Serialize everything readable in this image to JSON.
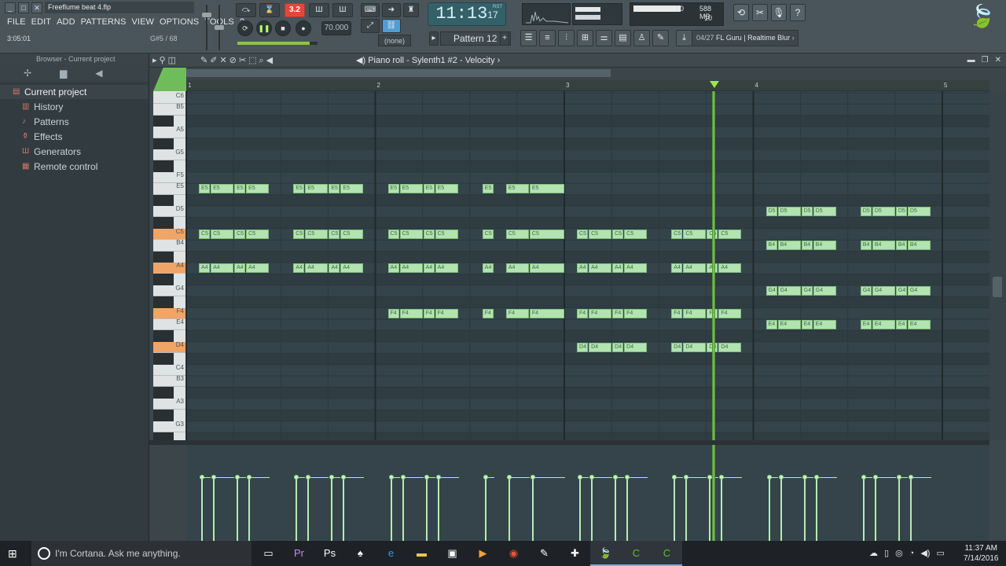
{
  "window": {
    "title": "Freeflume beat 4.flp",
    "controls": [
      "_",
      "□",
      "✕"
    ]
  },
  "menu": [
    "FILE",
    "EDIT",
    "ADD",
    "PATTERNS",
    "VIEW",
    "OPTIONS",
    "TOOLS",
    "?"
  ],
  "hints": {
    "left": "3:05:01",
    "right": "G#5 / 68"
  },
  "transport": {
    "snap_label": "3.2",
    "tempo": "70.000",
    "time_main": "11:13",
    "time_sub": "17",
    "time_corner": "RST",
    "pattern": "Pattern 12",
    "pattern_dest": "(none)",
    "tempo_slider_fraction": 0.9
  },
  "cpu": {
    "top": "10",
    "mem": "588 MB",
    "poly": "10"
  },
  "hint_panel": {
    "index": "04/27",
    "text": "FL Guru | Realtime Blur"
  },
  "browser": {
    "header": "Browser - Current project",
    "root": "Current project",
    "items": [
      {
        "label": "History",
        "icon": "history-icon"
      },
      {
        "label": "Patterns",
        "icon": "patterns-icon"
      },
      {
        "label": "Effects",
        "icon": "effects-icon"
      },
      {
        "label": "Generators",
        "icon": "generators-icon"
      },
      {
        "label": "Remote control",
        "icon": "remote-icon"
      }
    ]
  },
  "piano_roll": {
    "title": "Piano roll - Sylenth1 #2",
    "lane_title": "Velocity",
    "bar_numbers": [
      "1",
      "2",
      "3",
      "4",
      "5"
    ],
    "key_labels": [
      "C6",
      "B5",
      "A5",
      "G5",
      "F5",
      "E5",
      "D5",
      "C5",
      "B4",
      "A4",
      "G4",
      "F4",
      "E4",
      "D4",
      "C4",
      "B3",
      "A3",
      "G3"
    ],
    "highlighted_keys": [
      "C5",
      "A4",
      "F4",
      "D4"
    ]
  },
  "notes": [
    {
      "pitch": "E5",
      "start": 0.0625,
      "len": 0.0625
    },
    {
      "pitch": "E5",
      "start": 0.125,
      "len": 0.125
    },
    {
      "pitch": "E5",
      "start": 0.25,
      "len": 0.0625
    },
    {
      "pitch": "E5",
      "start": 0.3125,
      "len": 0.125
    },
    {
      "pitch": "E5",
      "start": 0.5625,
      "len": 0.0625
    },
    {
      "pitch": "E5",
      "start": 0.625,
      "len": 0.125
    },
    {
      "pitch": "E5",
      "start": 0.75,
      "len": 0.0625
    },
    {
      "pitch": "E5",
      "start": 0.8125,
      "len": 0.125
    },
    {
      "pitch": "E5",
      "start": 1.0625,
      "len": 0.0625
    },
    {
      "pitch": "E5",
      "start": 1.125,
      "len": 0.125
    },
    {
      "pitch": "E5",
      "start": 1.25,
      "len": 0.0625
    },
    {
      "pitch": "E5",
      "start": 1.3125,
      "len": 0.125
    },
    {
      "pitch": "E5",
      "start": 1.5625,
      "len": 0.0625
    },
    {
      "pitch": "E5",
      "start": 1.6875,
      "len": 0.125
    },
    {
      "pitch": "E5",
      "start": 1.8125,
      "len": 0.1875
    },
    {
      "pitch": "C5",
      "start": 0.0625,
      "len": 0.0625
    },
    {
      "pitch": "C5",
      "start": 0.125,
      "len": 0.125
    },
    {
      "pitch": "C5",
      "start": 0.25,
      "len": 0.0625
    },
    {
      "pitch": "C5",
      "start": 0.3125,
      "len": 0.125
    },
    {
      "pitch": "C5",
      "start": 0.5625,
      "len": 0.0625
    },
    {
      "pitch": "C5",
      "start": 0.625,
      "len": 0.125
    },
    {
      "pitch": "C5",
      "start": 0.75,
      "len": 0.0625
    },
    {
      "pitch": "C5",
      "start": 0.8125,
      "len": 0.125
    },
    {
      "pitch": "C5",
      "start": 1.0625,
      "len": 0.0625
    },
    {
      "pitch": "C5",
      "start": 1.125,
      "len": 0.125
    },
    {
      "pitch": "C5",
      "start": 1.25,
      "len": 0.0625
    },
    {
      "pitch": "C5",
      "start": 1.3125,
      "len": 0.125
    },
    {
      "pitch": "C5",
      "start": 1.5625,
      "len": 0.0625
    },
    {
      "pitch": "C5",
      "start": 1.6875,
      "len": 0.125
    },
    {
      "pitch": "C5",
      "start": 1.8125,
      "len": 0.1875
    },
    {
      "pitch": "C5",
      "start": 2.0625,
      "len": 0.0625
    },
    {
      "pitch": "C5",
      "start": 2.125,
      "len": 0.125
    },
    {
      "pitch": "C5",
      "start": 2.25,
      "len": 0.0625
    },
    {
      "pitch": "C5",
      "start": 2.3125,
      "len": 0.125
    },
    {
      "pitch": "C5",
      "start": 2.5625,
      "len": 0.0625
    },
    {
      "pitch": "C5",
      "start": 2.625,
      "len": 0.125
    },
    {
      "pitch": "C5",
      "start": 2.75,
      "len": 0.0625
    },
    {
      "pitch": "C5",
      "start": 2.8125,
      "len": 0.125
    },
    {
      "pitch": "A4",
      "start": 0.0625,
      "len": 0.0625
    },
    {
      "pitch": "A4",
      "start": 0.125,
      "len": 0.125
    },
    {
      "pitch": "A4",
      "start": 0.25,
      "len": 0.0625
    },
    {
      "pitch": "A4",
      "start": 0.3125,
      "len": 0.125
    },
    {
      "pitch": "A4",
      "start": 0.5625,
      "len": 0.0625
    },
    {
      "pitch": "A4",
      "start": 0.625,
      "len": 0.125
    },
    {
      "pitch": "A4",
      "start": 0.75,
      "len": 0.0625
    },
    {
      "pitch": "A4",
      "start": 0.8125,
      "len": 0.125
    },
    {
      "pitch": "A4",
      "start": 1.0625,
      "len": 0.0625
    },
    {
      "pitch": "A4",
      "start": 1.125,
      "len": 0.125
    },
    {
      "pitch": "A4",
      "start": 1.25,
      "len": 0.0625
    },
    {
      "pitch": "A4",
      "start": 1.3125,
      "len": 0.125
    },
    {
      "pitch": "A4",
      "start": 1.5625,
      "len": 0.0625
    },
    {
      "pitch": "A4",
      "start": 1.6875,
      "len": 0.125
    },
    {
      "pitch": "A4",
      "start": 1.8125,
      "len": 0.1875
    },
    {
      "pitch": "A4",
      "start": 2.0625,
      "len": 0.0625
    },
    {
      "pitch": "A4",
      "start": 2.125,
      "len": 0.125
    },
    {
      "pitch": "A4",
      "start": 2.25,
      "len": 0.0625
    },
    {
      "pitch": "A4",
      "start": 2.3125,
      "len": 0.125
    },
    {
      "pitch": "A4",
      "start": 2.5625,
      "len": 0.0625
    },
    {
      "pitch": "A4",
      "start": 2.625,
      "len": 0.125
    },
    {
      "pitch": "A4",
      "start": 2.75,
      "len": 0.0625
    },
    {
      "pitch": "A4",
      "start": 2.8125,
      "len": 0.125
    },
    {
      "pitch": "F4",
      "start": 1.0625,
      "len": 0.0625
    },
    {
      "pitch": "F4",
      "start": 1.125,
      "len": 0.125
    },
    {
      "pitch": "F4",
      "start": 1.25,
      "len": 0.0625
    },
    {
      "pitch": "F4",
      "start": 1.3125,
      "len": 0.125
    },
    {
      "pitch": "F4",
      "start": 1.5625,
      "len": 0.0625
    },
    {
      "pitch": "F4",
      "start": 1.6875,
      "len": 0.125
    },
    {
      "pitch": "F4",
      "start": 1.8125,
      "len": 0.1875
    },
    {
      "pitch": "F4",
      "start": 2.0625,
      "len": 0.0625
    },
    {
      "pitch": "F4",
      "start": 2.125,
      "len": 0.125
    },
    {
      "pitch": "F4",
      "start": 2.25,
      "len": 0.0625
    },
    {
      "pitch": "F4",
      "start": 2.3125,
      "len": 0.125
    },
    {
      "pitch": "F4",
      "start": 2.5625,
      "len": 0.0625
    },
    {
      "pitch": "F4",
      "start": 2.625,
      "len": 0.125
    },
    {
      "pitch": "F4",
      "start": 2.75,
      "len": 0.0625
    },
    {
      "pitch": "F4",
      "start": 2.8125,
      "len": 0.125
    },
    {
      "pitch": "D4",
      "start": 2.0625,
      "len": 0.0625
    },
    {
      "pitch": "D4",
      "start": 2.125,
      "len": 0.125
    },
    {
      "pitch": "D4",
      "start": 2.25,
      "len": 0.0625
    },
    {
      "pitch": "D4",
      "start": 2.3125,
      "len": 0.125
    },
    {
      "pitch": "D4",
      "start": 2.5625,
      "len": 0.0625
    },
    {
      "pitch": "D4",
      "start": 2.625,
      "len": 0.125
    },
    {
      "pitch": "D4",
      "start": 2.75,
      "len": 0.0625
    },
    {
      "pitch": "D4",
      "start": 2.8125,
      "len": 0.125
    },
    {
      "pitch": "D5",
      "start": 3.0625,
      "len": 0.0625
    },
    {
      "pitch": "D5",
      "start": 3.125,
      "len": 0.125
    },
    {
      "pitch": "D5",
      "start": 3.25,
      "len": 0.0625
    },
    {
      "pitch": "D5",
      "start": 3.3125,
      "len": 0.125
    },
    {
      "pitch": "D5",
      "start": 3.5625,
      "len": 0.0625
    },
    {
      "pitch": "D5",
      "start": 3.625,
      "len": 0.125
    },
    {
      "pitch": "D5",
      "start": 3.75,
      "len": 0.0625
    },
    {
      "pitch": "D5",
      "start": 3.8125,
      "len": 0.125
    },
    {
      "pitch": "B4",
      "start": 3.0625,
      "len": 0.0625
    },
    {
      "pitch": "B4",
      "start": 3.125,
      "len": 0.125
    },
    {
      "pitch": "B4",
      "start": 3.25,
      "len": 0.0625
    },
    {
      "pitch": "B4",
      "start": 3.3125,
      "len": 0.125
    },
    {
      "pitch": "B4",
      "start": 3.5625,
      "len": 0.0625
    },
    {
      "pitch": "B4",
      "start": 3.625,
      "len": 0.125
    },
    {
      "pitch": "B4",
      "start": 3.75,
      "len": 0.0625
    },
    {
      "pitch": "B4",
      "start": 3.8125,
      "len": 0.125
    },
    {
      "pitch": "G4",
      "start": 3.0625,
      "len": 0.0625
    },
    {
      "pitch": "G4",
      "start": 3.125,
      "len": 0.125
    },
    {
      "pitch": "G4",
      "start": 3.25,
      "len": 0.0625
    },
    {
      "pitch": "G4",
      "start": 3.3125,
      "len": 0.125
    },
    {
      "pitch": "G4",
      "start": 3.5625,
      "len": 0.0625
    },
    {
      "pitch": "G4",
      "start": 3.625,
      "len": 0.125
    },
    {
      "pitch": "G4",
      "start": 3.75,
      "len": 0.0625
    },
    {
      "pitch": "G4",
      "start": 3.8125,
      "len": 0.125
    },
    {
      "pitch": "E4",
      "start": 3.0625,
      "len": 0.0625
    },
    {
      "pitch": "E4",
      "start": 3.125,
      "len": 0.125
    },
    {
      "pitch": "E4",
      "start": 3.25,
      "len": 0.0625
    },
    {
      "pitch": "E4",
      "start": 3.3125,
      "len": 0.125
    },
    {
      "pitch": "E4",
      "start": 3.5625,
      "len": 0.0625
    },
    {
      "pitch": "E4",
      "start": 3.625,
      "len": 0.125
    },
    {
      "pitch": "E4",
      "start": 3.75,
      "len": 0.0625
    },
    {
      "pitch": "E4",
      "start": 3.8125,
      "len": 0.125
    }
  ],
  "playhead_bar_position": 3.7,
  "taskbar": {
    "search_placeholder": "I'm Cortana. Ask me anything.",
    "apps": [
      "task-view-icon",
      "premiere-icon",
      "photoshop-icon",
      "gamepad-icon",
      "edge-icon",
      "explorer-icon",
      "store-icon",
      "media-icon",
      "chrome-icon",
      "notepad-icon",
      "controller-icon",
      "fl-studio-icon",
      "camtasia-icon",
      "camtasia2-icon"
    ],
    "time": "11:37 AM",
    "date": "7/14/2016"
  },
  "colors": {
    "accent": "#8bd64f",
    "note": "#b3e3b1",
    "grid": "#35444b"
  }
}
